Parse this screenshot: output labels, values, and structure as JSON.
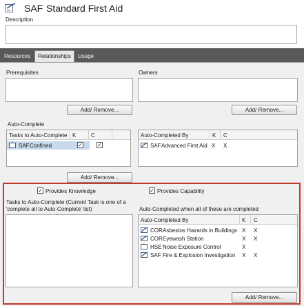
{
  "header": {
    "code": "SAF",
    "name": "Standard First Aid",
    "description_label": "Description",
    "description_value": ""
  },
  "tabs": [
    {
      "label": "Resources",
      "active": false
    },
    {
      "label": "Relationships",
      "active": true
    },
    {
      "label": "Usage",
      "active": false
    }
  ],
  "prerequisites": {
    "label": "Prerequisites",
    "button": "Add/ Remove..."
  },
  "owners": {
    "label": "Owners",
    "button": "Add/ Remove..."
  },
  "auto_complete": {
    "label": "Auto-Complete",
    "tasks_grid": {
      "columns": [
        "Tasks to Auto-Complete",
        "K",
        "C"
      ],
      "rows": [
        {
          "code": "SAF",
          "name": "Confined",
          "k": "✓",
          "c": "✓"
        }
      ]
    },
    "completed_by_grid": {
      "columns": [
        "Auto-Completed By",
        "K",
        "C"
      ],
      "rows": [
        {
          "code": "SAF",
          "name": "Advanced First Aid",
          "k": "X",
          "c": "X"
        }
      ]
    },
    "button": "Add/ Remove..."
  },
  "provides": {
    "knowledge_label": "Provides Knowledge",
    "knowledge_checked": "✓",
    "capability_label": "Provides Capability",
    "capability_checked": "✓",
    "tasks_label_line1": "Tasks to Auto-Complete (Current Task is one of a",
    "tasks_label_line2": "'complete all to Auto-Complete' list)",
    "completed_when_label": "Auto-Completed when all of these are completed",
    "completed_grid": {
      "columns": [
        "Auto-Completed By",
        "K",
        "C"
      ],
      "rows": [
        {
          "code": "COR",
          "name": "Asbestos Hazards in Buildings",
          "k": "X",
          "c": "X",
          "icon": "linked"
        },
        {
          "code": "COR",
          "name": "Eyewash Station",
          "k": "X",
          "c": "X",
          "icon": "linked"
        },
        {
          "code": "HSE",
          "name": "Noise Exposure Control",
          "k": "X",
          "c": "",
          "icon": "plain"
        },
        {
          "code": "SAF",
          "name": "Fire & Explosion Investigation",
          "k": "X",
          "c": "X",
          "icon": "linked"
        }
      ]
    },
    "button": "Add/ Remove..."
  }
}
